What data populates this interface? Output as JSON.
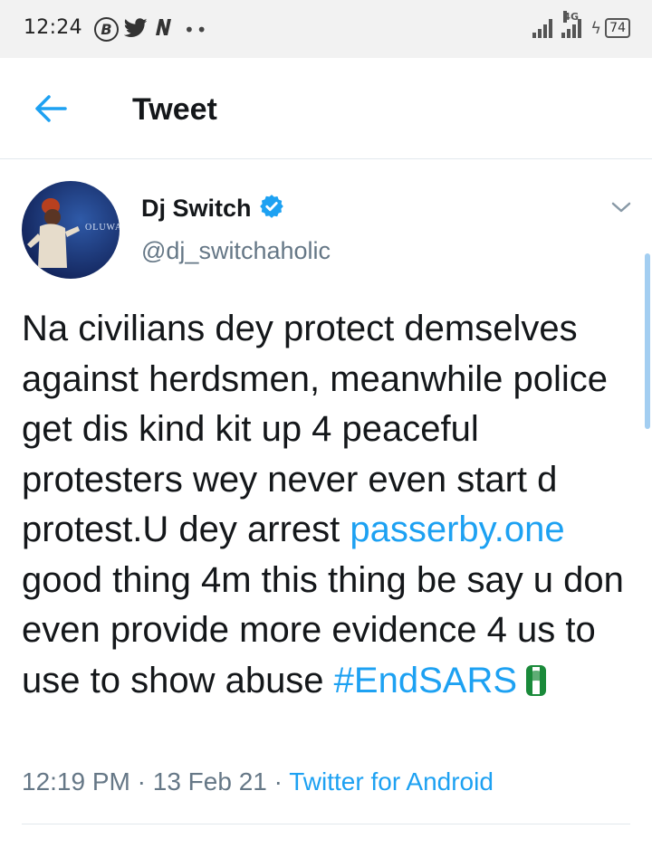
{
  "status_bar": {
    "time": "12:24",
    "icons": [
      "b-circle-icon",
      "twitter-icon",
      "n-icon",
      "more-dots-icon"
    ],
    "network": "4G",
    "battery": "74"
  },
  "header": {
    "title": "Tweet"
  },
  "tweet": {
    "author": {
      "name": "Dj Switch",
      "handle": "@dj_switchaholic",
      "verified": true,
      "avatar_text": "OLUWA"
    },
    "text_before_link": "Na civilians dey protect demselves against herdsmen, meanwhile police get dis kind kit up 4 peaceful protesters wey never even start d protest.U dey arrest ",
    "link": "passerby.one",
    "text_after_link": " good thing 4m this thing be say u don even provide more evidence 4 us to use to show abuse ",
    "hashtag": "#EndSARS",
    "emoji": "raised-fist-nigeria-flag-icon",
    "time": "12:19 PM",
    "separator": " · ",
    "date": "13 Feb 21",
    "source": "Twitter for Android"
  },
  "colors": {
    "accent": "#1da1f2",
    "text": "#14171a",
    "muted": "#657786",
    "divider": "#e1e8ed",
    "status_bg": "#f2f2f2"
  }
}
